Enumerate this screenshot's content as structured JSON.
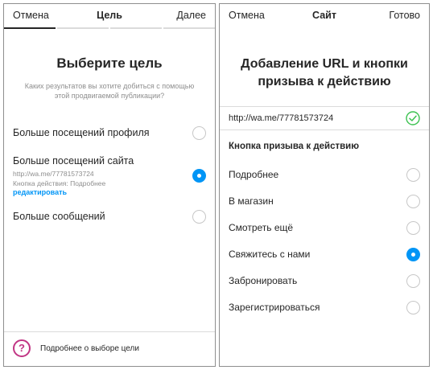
{
  "left": {
    "nav": {
      "cancel": "Отмена",
      "title": "Цель",
      "next": "Далее"
    },
    "heading": "Выберите цель",
    "subtext": "Каких результатов вы хотите добиться с помощью этой продвигаемой публикации?",
    "options": [
      {
        "label": "Больше посещений профиля",
        "selected": false
      },
      {
        "label": "Больше посещений сайта",
        "selected": true,
        "url": "http://wa.me/77781573724",
        "cta_line": "Кнопка действия: Подробнее",
        "edit": "редактировать"
      },
      {
        "label": "Больше сообщений",
        "selected": false
      }
    ],
    "help": {
      "icon": "?",
      "label": "Подробнее о выборе цели"
    }
  },
  "right": {
    "nav": {
      "cancel": "Отмена",
      "title": "Сайт",
      "done": "Готово"
    },
    "heading_line1": "Добавление URL и кнопки",
    "heading_line2": "призыва к действию",
    "url_value": "http://wa.me/77781573724",
    "cta_section_label": "Кнопка призыва к действию",
    "cta_options": [
      {
        "label": "Подробнее",
        "selected": false
      },
      {
        "label": "В магазин",
        "selected": false
      },
      {
        "label": "Смотреть ещё",
        "selected": false
      },
      {
        "label": "Свяжитесь с нами",
        "selected": true
      },
      {
        "label": "Забронировать",
        "selected": false
      },
      {
        "label": "Зарегистрироваться",
        "selected": false
      }
    ]
  },
  "colors": {
    "accent": "#0095f6",
    "success": "#3cc251",
    "help": "#c13584",
    "divider": "#dbdbdb"
  }
}
